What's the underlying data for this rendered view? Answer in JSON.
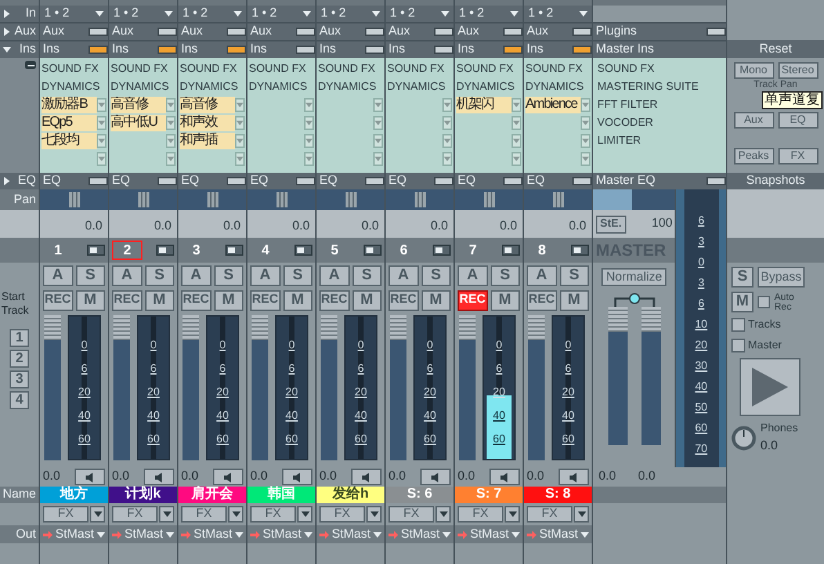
{
  "sidebar": {
    "in": "In",
    "aux": "Aux",
    "ins": "Ins",
    "eq": "EQ",
    "pan": "Pan",
    "start_track": "Start Track",
    "track_buttons": [
      "1",
      "2",
      "3",
      "4"
    ],
    "name": "Name",
    "out": "Out"
  },
  "channels": [
    {
      "input": "1 • 2",
      "aux": "Aux",
      "aux_on": false,
      "ins": "Ins",
      "ins_on": true,
      "groups": [
        "SOUND FX",
        "DYNAMICS"
      ],
      "slots": [
        {
          "kind": "plugin",
          "text": "激励器B"
        },
        {
          "kind": "plugin",
          "text": "EQp5"
        },
        {
          "kind": "plugin",
          "text": "七段均"
        },
        {
          "kind": "empty"
        }
      ],
      "eq": "EQ",
      "eq_on": false,
      "pan": {
        "level": 0.5
      },
      "pan_value": "0.0",
      "number": "1",
      "selected": false,
      "a": "A",
      "s": "S",
      "rec": "REC",
      "rec_on": false,
      "m": "M",
      "fader": {
        "level": 1
      },
      "meter": {
        "level": 0
      },
      "scale": [
        "0",
        "6",
        "20",
        "40",
        "60"
      ],
      "volume": "0.0",
      "name": "地方",
      "color": "#00a0d8",
      "fx": "FX",
      "out": "StMast"
    },
    {
      "input": "1 • 2",
      "aux": "Aux",
      "aux_on": false,
      "ins": "Ins",
      "ins_on": true,
      "groups": [
        "SOUND FX",
        "DYNAMICS"
      ],
      "slots": [
        {
          "kind": "plugin",
          "text": "高音修"
        },
        {
          "kind": "plugin",
          "text": "高中低U"
        },
        {
          "kind": "empty"
        },
        {
          "kind": "empty"
        }
      ],
      "eq": "EQ",
      "eq_on": false,
      "pan": {
        "level": 0.5
      },
      "pan_value": "0.0",
      "number": "2",
      "selected": true,
      "a": "A",
      "s": "S",
      "rec": "REC",
      "rec_on": false,
      "m": "M",
      "fader": {
        "level": 1
      },
      "meter": {
        "level": 0
      },
      "scale": [
        "0",
        "6",
        "20",
        "40",
        "60"
      ],
      "volume": "0.0",
      "name": "计划k",
      "color": "#40108a",
      "fx": "FX",
      "out": "StMast"
    },
    {
      "input": "1 • 2",
      "aux": "Aux",
      "aux_on": false,
      "ins": "Ins",
      "ins_on": true,
      "groups": [
        "SOUND FX",
        "DYNAMICS"
      ],
      "slots": [
        {
          "kind": "plugin",
          "text": "高音修"
        },
        {
          "kind": "plugin",
          "text": "和声效"
        },
        {
          "kind": "plugin",
          "text": "和声插"
        },
        {
          "kind": "empty"
        }
      ],
      "eq": "EQ",
      "eq_on": false,
      "pan": {
        "level": 0.5
      },
      "pan_value": "0.0",
      "number": "3",
      "selected": false,
      "a": "A",
      "s": "S",
      "rec": "REC",
      "rec_on": false,
      "m": "M",
      "fader": {
        "level": 1
      },
      "meter": {
        "level": 0
      },
      "scale": [
        "0",
        "6",
        "20",
        "40",
        "60"
      ],
      "volume": "0.0",
      "name": "肩开会",
      "color": "#ff0a80",
      "fx": "FX",
      "out": "StMast"
    },
    {
      "input": "1 • 2",
      "aux": "Aux",
      "aux_on": false,
      "ins": "Ins",
      "ins_on": false,
      "groups": [
        "SOUND FX",
        "DYNAMICS"
      ],
      "slots": [
        {
          "kind": "empty"
        },
        {
          "kind": "empty"
        },
        {
          "kind": "empty"
        },
        {
          "kind": "empty"
        }
      ],
      "eq": "EQ",
      "eq_on": false,
      "pan": {
        "level": 0.5
      },
      "pan_value": "0.0",
      "number": "4",
      "selected": false,
      "a": "A",
      "s": "S",
      "rec": "REC",
      "rec_on": false,
      "m": "M",
      "fader": {
        "level": 1
      },
      "meter": {
        "level": 0
      },
      "scale": [
        "0",
        "6",
        "20",
        "40",
        "60"
      ],
      "volume": "0.0",
      "name": "韩国",
      "color": "#00e878",
      "fx": "FX",
      "out": "StMast"
    },
    {
      "input": "1 • 2",
      "aux": "Aux",
      "aux_on": false,
      "ins": "Ins",
      "ins_on": false,
      "groups": [
        "SOUND FX",
        "DYNAMICS"
      ],
      "slots": [
        {
          "kind": "empty"
        },
        {
          "kind": "empty"
        },
        {
          "kind": "empty"
        },
        {
          "kind": "empty"
        }
      ],
      "eq": "EQ",
      "eq_on": false,
      "pan": {
        "level": 0.5
      },
      "pan_value": "0.0",
      "number": "5",
      "selected": false,
      "a": "A",
      "s": "S",
      "rec": "REC",
      "rec_on": false,
      "m": "M",
      "fader": {
        "level": 1
      },
      "meter": {
        "level": 0
      },
      "scale": [
        "0",
        "6",
        "20",
        "40",
        "60"
      ],
      "volume": "0.0",
      "name": "发给h",
      "color": "#ffff80",
      "fx": "FX",
      "out": "StMast"
    },
    {
      "input": "1 • 2",
      "aux": "Aux",
      "aux_on": false,
      "ins": "Ins",
      "ins_on": false,
      "groups": [
        "SOUND FX",
        "DYNAMICS"
      ],
      "slots": [
        {
          "kind": "empty"
        },
        {
          "kind": "empty"
        },
        {
          "kind": "empty"
        },
        {
          "kind": "empty"
        }
      ],
      "eq": "EQ",
      "eq_on": false,
      "pan": {
        "level": 0.5
      },
      "pan_value": "0.0",
      "number": "6",
      "selected": false,
      "a": "A",
      "s": "S",
      "rec": "REC",
      "rec_on": false,
      "m": "M",
      "fader": {
        "level": 1
      },
      "meter": {
        "level": 0
      },
      "scale": [
        "0",
        "6",
        "20",
        "40",
        "60"
      ],
      "volume": "0.0",
      "name": "S: 6",
      "color": "#8a8f92",
      "fx": "FX",
      "out": "StMast"
    },
    {
      "input": "1 • 2",
      "aux": "Aux",
      "aux_on": false,
      "ins": "Ins",
      "ins_on": true,
      "groups": [
        "SOUND FX",
        "DYNAMICS"
      ],
      "slots": [
        {
          "kind": "plugin",
          "text": "机架闪"
        },
        {
          "kind": "empty"
        },
        {
          "kind": "empty"
        },
        {
          "kind": "empty"
        }
      ],
      "eq": "EQ",
      "eq_on": false,
      "pan": {
        "level": 0.5
      },
      "pan_value": "0.0",
      "number": "7",
      "selected": false,
      "a": "A",
      "s": "S",
      "rec": "REC",
      "rec_on": true,
      "m": "M",
      "fader": {
        "level": 1
      },
      "meter": {
        "level": 0.45
      },
      "scale": [
        "0",
        "6",
        "20",
        "40",
        "60"
      ],
      "volume": "0.0",
      "name": "S: 7",
      "color": "#ff8030",
      "fx": "FX",
      "out": "StMast"
    },
    {
      "input": "1 • 2",
      "aux": "Aux",
      "aux_on": false,
      "ins": "Ins",
      "ins_on": true,
      "groups": [
        "SOUND FX",
        "DYNAMICS"
      ],
      "slots": [
        {
          "kind": "plugin",
          "text": "Ambience"
        },
        {
          "kind": "empty"
        },
        {
          "kind": "empty"
        },
        {
          "kind": "empty"
        }
      ],
      "eq": "EQ",
      "eq_on": false,
      "pan": {
        "level": 0.5
      },
      "pan_value": "0.0",
      "number": "8",
      "selected": false,
      "a": "A",
      "s": "S",
      "rec": "REC",
      "rec_on": false,
      "m": "M",
      "fader": {
        "level": 1
      },
      "meter": {
        "level": 0
      },
      "scale": [
        "0",
        "6",
        "20",
        "40",
        "60"
      ],
      "volume": "0.0",
      "name": "S: 8",
      "color": "#ff1010",
      "fx": "FX",
      "out": "StMast"
    }
  ],
  "master": {
    "aux": "Plugins",
    "aux_on": false,
    "ins": "Master Ins",
    "plugins": [
      "SOUND FX",
      "MASTERING SUITE",
      "FFT FILTER",
      "VOCODER",
      "LIMITER"
    ],
    "eq": "Master EQ",
    "eq_on": false,
    "ste": "StE.",
    "value": "100",
    "title": "MASTER",
    "normalize": "Normalize",
    "faders": [
      {
        "level": 1,
        "value": "0.0"
      },
      {
        "level": 1,
        "value": "0.0"
      }
    ],
    "scale": [
      "6",
      "3",
      "0",
      "3",
      "6",
      "10",
      "20",
      "30",
      "40",
      "50",
      "60",
      "70"
    ]
  },
  "right": {
    "reset": "Reset",
    "mono": "Mono",
    "stereo": "Stereo",
    "track_pan": "Track Pan",
    "tooltip": "单声道复",
    "aux": "Aux",
    "eq": "EQ",
    "peaks": "Peaks",
    "fx": "FX",
    "snapshots": "Snapshots",
    "solo": "S",
    "bypass": "Bypass",
    "mute": "M",
    "auto_rec": {
      "label": "Auto Rec",
      "checked": false
    },
    "tracks": {
      "label": "Tracks",
      "checked": false
    },
    "master": {
      "label": "Master",
      "checked": false
    },
    "phones": "Phones",
    "phones_value": "0.0"
  }
}
